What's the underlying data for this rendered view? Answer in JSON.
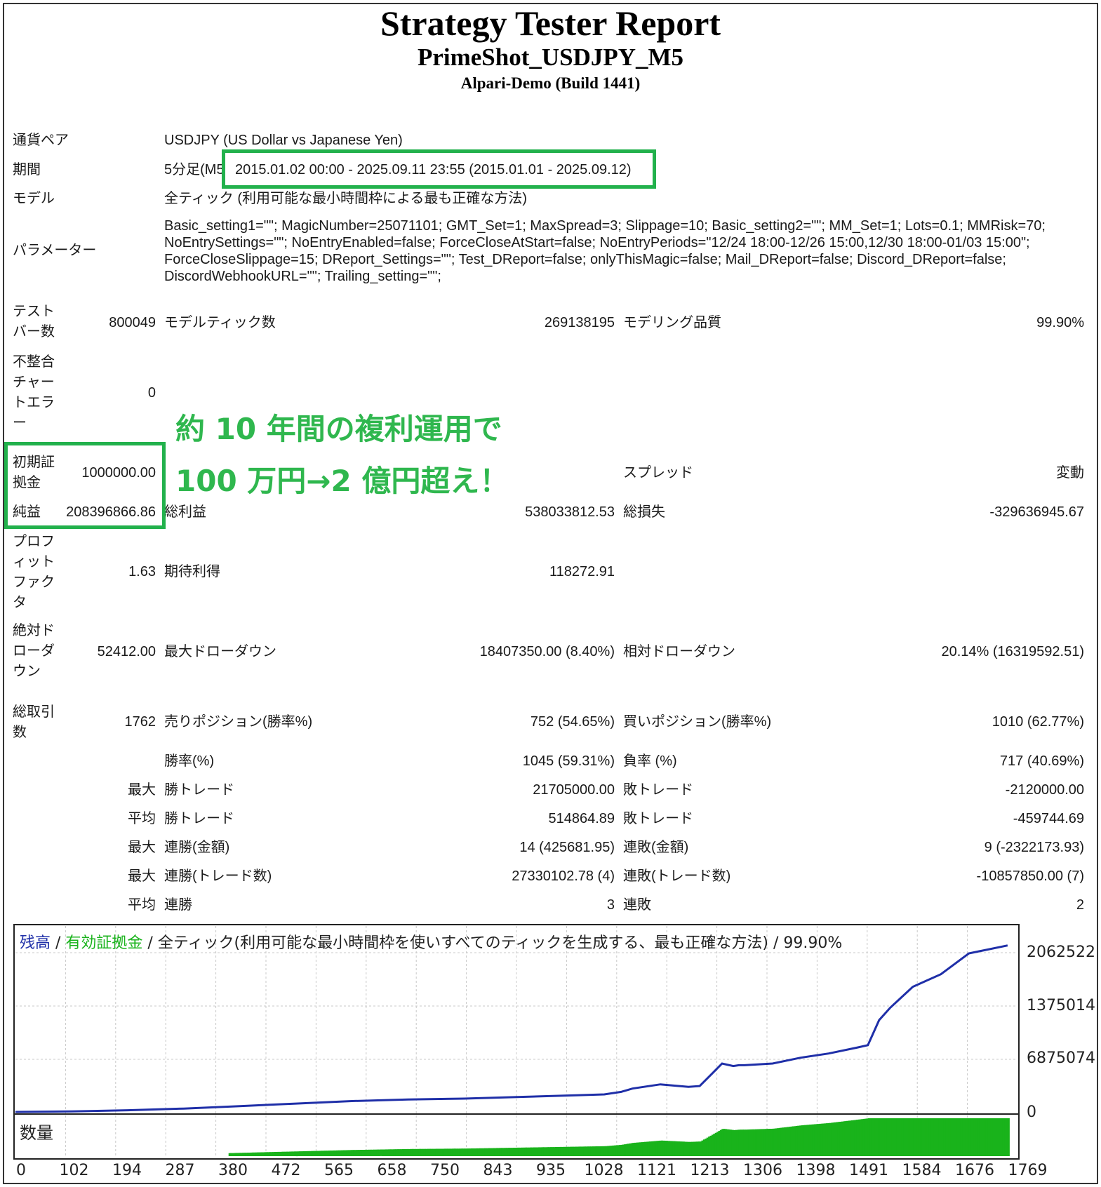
{
  "header": {
    "title": "Strategy Tester Report",
    "ea_name": "PrimeShot_USDJPY_M5",
    "server": "Alpari-Demo (Build 1441)"
  },
  "info": {
    "symbol_label": "通貨ペア",
    "symbol_value": "USDJPY (US Dollar vs Japanese Yen)",
    "period_label": "期間",
    "period_prefix": "5分足(M5",
    "period_value": "2015.01.02 00:00 - 2025.09.11 23:55 (2015.01.01 - 2025.09.12)",
    "model_label": "モデル",
    "model_value": "全ティック (利用可能な最小時間枠による最も正確な方法)",
    "params_label": "パラメーター",
    "params_lines": [
      "Basic_setting1=\"\"; MagicNumber=25071101; GMT_Set=1; MaxSpread=3; Slippage=10; Basic_setting2=\"\"; MM_Set=1; Lots=0.1; MMRisk=70;",
      "NoEntrySettings=\"\"; NoEntryEnabled=false; ForceCloseAtStart=false; NoEntryPeriods=\"12/24 18:00-12/26 15:00,12/30 18:00-01/03 15:00\";",
      "ForceCloseSlippage=15; DReport_Settings=\"\"; Test_DReport=false; onlyThisMagic=false; Mail_DReport=false; Discord_DReport=false;",
      "DiscordWebhookURL=\"\"; Trailing_setting=\"\";"
    ]
  },
  "stats": {
    "bars_label": "テストバー数",
    "bars_value": "800049",
    "ticks_label": "モデルティック数",
    "ticks_value": "269138195",
    "quality_label": "モデリング品質",
    "quality_value": "99.90%",
    "mismatch_label": "不整合チャートエラー",
    "mismatch_value": "0",
    "deposit_label": "初期証拠金",
    "deposit_value": "1000000.00",
    "spread_label": "スプレッド",
    "spread_value": "変動",
    "net_label": "純益",
    "net_value": "208396866.86",
    "gross_profit_label": "総利益",
    "gross_profit_value": "538033812.53",
    "gross_loss_label": "総損失",
    "gross_loss_value": "-329636945.67",
    "pf_label": "プロフィットファクタ",
    "pf_value": "1.63",
    "expected_label": "期待利得",
    "expected_value": "118272.91",
    "abs_dd_label": "絶対ドローダウン",
    "abs_dd_value": "52412.00",
    "max_dd_label": "最大ドローダウン",
    "max_dd_value": "18407350.00 (8.40%)",
    "rel_dd_label": "相対ドローダウン",
    "rel_dd_value": "20.14% (16319592.51)",
    "trades_label": "総取引数",
    "trades_value": "1762",
    "short_label": "売りポジション(勝率%)",
    "short_value": "752 (54.65%)",
    "long_label": "買いポジション(勝率%)",
    "long_value": "1010 (62.77%)",
    "win_label": "勝率(%)",
    "win_value": "1045 (59.31%)",
    "loss_label": "負率 (%)",
    "loss_value": "717 (40.69%)",
    "rows": [
      {
        "prefix": "最大",
        "l1": "勝トレード",
        "v1": "21705000.00",
        "l2": "敗トレード",
        "v2": "-2120000.00"
      },
      {
        "prefix": "平均",
        "l1": "勝トレード",
        "v1": "514864.89",
        "l2": "敗トレード",
        "v2": "-459744.69"
      },
      {
        "prefix": "最大",
        "l1": "連勝(金額)",
        "v1": "14 (425681.95)",
        "l2": "連敗(金額)",
        "v2": "9 (-2322173.93)"
      },
      {
        "prefix": "最大",
        "l1": "連勝(トレード数)",
        "v1": "27330102.78 (4)",
        "l2": "連敗(トレード数)",
        "v2": "-10857850.00 (7)"
      },
      {
        "prefix": "平均",
        "l1": "連勝",
        "v1": "3",
        "l2": "連敗",
        "v2": "2"
      }
    ]
  },
  "overlay": {
    "line1": "約 10 年間の複利運用で",
    "line2": "100 万円→2 億円超え！",
    "color": "#2fb74e"
  },
  "chart_legend": {
    "balance": "残高",
    "sep1": " / ",
    "equity": "有効証拠金",
    "rest": " / 全ティック(利用可能な最小時間枠を使いすべてのティックを生成する、最も正確な方法) / 99.90%",
    "balance_color": "#1f2fa8",
    "equity_color": "#19b31b"
  },
  "volume_label": "数量",
  "chart_data": {
    "type": "line",
    "ylim": [
      0,
      2062522
    ],
    "y_tick_labels": [
      "2062522",
      "1375014",
      "6875074",
      "0"
    ],
    "x_tick_labels": [
      "0",
      "102",
      "194",
      "287",
      "380",
      "472",
      "565",
      "658",
      "750",
      "843",
      "935",
      "1028",
      "1121",
      "1213",
      "1306",
      "1398",
      "1491",
      "1584",
      "1676",
      "1769"
    ],
    "x": [
      0,
      100,
      200,
      300,
      400,
      500,
      600,
      700,
      800,
      900,
      1000,
      1050,
      1080,
      1100,
      1150,
      1200,
      1220,
      1260,
      1280,
      1290,
      1300,
      1350,
      1400,
      1450,
      1500,
      1520,
      1540,
      1560,
      1600,
      1650,
      1700,
      1769
    ],
    "series": [
      {
        "values": [
          0,
          6000,
          20000,
          40000,
          70000,
          100000,
          130000,
          150000,
          160000,
          180000,
          200000,
          210000,
          240000,
          280000,
          330000,
          300000,
          310000,
          580000,
          550000,
          560000,
          560000,
          580000,
          650000,
          700000,
          770000,
          800000,
          1100000,
          1250000,
          1500000,
          1650000,
          1900000,
          1995000
        ]
      }
    ]
  },
  "colors": {
    "highlight_box": "#22b14c",
    "balance_line": "#1f2fa8",
    "volume_bars": "#19b31b",
    "grid": "#c8c8c8"
  }
}
